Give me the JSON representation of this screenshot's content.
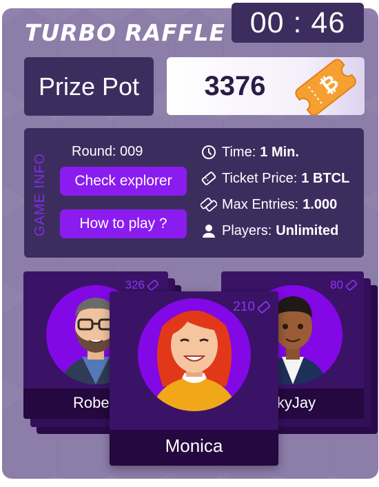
{
  "header": {
    "title": "TURBO RAFFLE",
    "timer": "00 : 46"
  },
  "prize": {
    "label": "Prize Pot",
    "value": "3376"
  },
  "game_info": {
    "vertical_label": "GAME INFO",
    "round": "Round: 009",
    "check_explorer": "Check explorer",
    "how_to_play": "How to play ?",
    "stats": [
      {
        "icon": "clock-icon",
        "label": "Time:",
        "value": "1 Min."
      },
      {
        "icon": "ticket-icon",
        "label": "Ticket Price:",
        "value": "1 BTCL"
      },
      {
        "icon": "tickets-icon",
        "label": "Max Entries:",
        "value": "1.000"
      },
      {
        "icon": "user-icon",
        "label": "Players:",
        "value": "Unlimited"
      }
    ]
  },
  "players": [
    {
      "name": "Robert",
      "tickets": "326"
    },
    {
      "name": "Monica",
      "tickets": "210"
    },
    {
      "name": "ckyJay",
      "tickets": "80"
    }
  ],
  "colors": {
    "panel": "#8d7da9",
    "dark_box": "#3c2d5e",
    "accent_purple": "#8b1cf0",
    "card": "#3a1366",
    "ticket_orange": "#f5a030"
  }
}
